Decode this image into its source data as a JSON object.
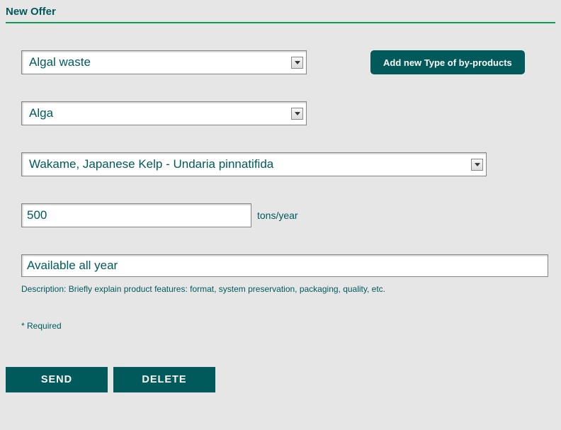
{
  "page": {
    "title": "New Offer"
  },
  "form": {
    "byproduct_type": {
      "value": "Algal waste"
    },
    "category": {
      "value": "Alga"
    },
    "species": {
      "value": "Wakame, Japanese Kelp - Undaria pinnatifida"
    },
    "quantity": {
      "value": "500",
      "unit": "tons/year"
    },
    "description": {
      "value": "Available all year",
      "helper": "Description: Briefly explain product features: format, system preservation, packaging, quality, etc."
    },
    "required_label": "* Required"
  },
  "buttons": {
    "add_type": "Add new Type of by-products",
    "send": "SEND",
    "delete": "DELETE"
  }
}
